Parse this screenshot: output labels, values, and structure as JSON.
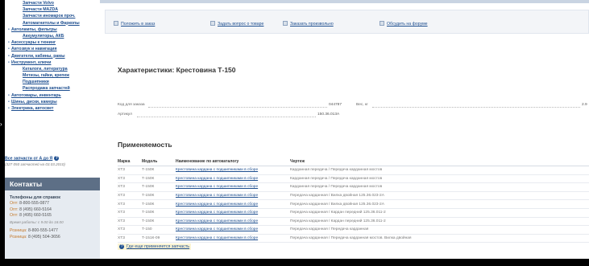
{
  "sidebar": {
    "items": [
      {
        "label": "Запчасти Volvo",
        "top": false
      },
      {
        "label": "Запчасти MAZDA",
        "top": false
      },
      {
        "label": "Запчасти иномарок проч.",
        "top": false
      },
      {
        "label": "Автомагнитолы и Фаркопы",
        "top": false
      },
      {
        "label": "Автолампы, фильтры",
        "top": true
      },
      {
        "label": "Аккумуляторы, АКБ",
        "top": false
      },
      {
        "label": "Аксессуары к тюнинг",
        "top": true
      },
      {
        "label": "Автозвук и навигация",
        "top": true
      },
      {
        "label": "Двигатели, кабины, рамы",
        "top": true
      },
      {
        "label": "Инструмент, ключи",
        "top": true
      },
      {
        "label": "Каталоги, литература",
        "top": false
      },
      {
        "label": "Метизы, гайки, крепеж",
        "top": false
      },
      {
        "label": "Подшипники",
        "top": false
      },
      {
        "label": "Распродажа запчастей",
        "top": false
      },
      {
        "label": "Автотовары, инвентарь",
        "top": true
      },
      {
        "label": "Шины, диски, камеры",
        "top": true
      },
      {
        "label": "Электрика, автосвет",
        "top": true
      }
    ],
    "total_link": "Все запчасти от А до Я",
    "total_note": "(327 050 запчастей на 03.03.2010)"
  },
  "contacts": {
    "title": "Контакты",
    "phones_title": "Телефоны для справок",
    "lines": [
      {
        "label": "Опт:",
        "value": "8-800-555-0877",
        "italic": false
      },
      {
        "label": "Опт:",
        "value": "8 (495) 660-5164",
        "italic": false
      },
      {
        "label": "Опт:",
        "value": "8 (495) 660-5165",
        "italic": false
      },
      {
        "label": "",
        "value": "Время работы: с 9.00 до 18.00",
        "italic": true
      }
    ],
    "retail_lines": [
      {
        "label": "Розница:",
        "value": "8-800-555-1477"
      },
      {
        "label": "Розница:",
        "value": "8 (495) 504-3656"
      }
    ]
  },
  "actions": [
    {
      "label": "Положить в заказ"
    },
    {
      "label": "Задать вопрос о товаре"
    },
    {
      "label": "Заказать произвольно"
    },
    {
      "label": "Обсудить на форуме"
    }
  ],
  "characteristics": {
    "heading": "Характеристики: Крестовина Т-150",
    "code_label": "Код для заказа",
    "code_value": "044787",
    "weight_label": "Вес, кг",
    "weight_value": "2.9",
    "article_label": "Артикул",
    "article_value": "150.36.013А"
  },
  "applicability": {
    "heading": "Применяемость",
    "columns": [
      "Марка",
      "Модель",
      "Наименование по автокаталогу",
      "Чертеж"
    ],
    "rows": [
      [
        "ХТЗ",
        "Т-150К",
        "Крестовина кардана с подшипниками в сборе",
        "Карданная передача / Передача карданная мостов"
      ],
      [
        "ХТЗ",
        "Т-150К",
        "Крестовина кардана с подшипниками в сборе",
        "Карданная передача / Передача карданная мостов"
      ],
      [
        "ХТЗ",
        "Т-150К",
        "Крестовина кардана с подшипниками в сборе",
        "Карданная передача / Передача карданная мостов"
      ],
      [
        "ХТЗ",
        "Т-150К",
        "Крестовина кардана с подшипниками в сборе",
        "Передача карданная / Вилка двойная 125.36.023-2А"
      ],
      [
        "ХТЗ",
        "Т-150К",
        "Крестовина кардана с подшипниками в сборе",
        "Передача карданная / Вилка двойная 125.36.023-2А"
      ],
      [
        "ХТЗ",
        "Т-150К",
        "Крестовина кардана с подшипниками в сборе",
        "Передача карданная / Кардан передний 125.36.011-2"
      ],
      [
        "ХТЗ",
        "Т-150К",
        "Крестовина кардана с подшипниками в сборе",
        "Передача карданная / Кардан передний 125.36.011-2"
      ],
      [
        "ХТЗ",
        "Т-150",
        "Крестовина кардана с подшипниками в сборе",
        "Передача карданная / Передача карданная"
      ],
      [
        "ХТЗ",
        "Т-151К-09",
        "Крестовина кардана с подшипниками в сборе",
        "Передача карданная / Передача карданная мостов. Вилка двойная"
      ]
    ],
    "more_link": "Где еще применяется запчасть"
  }
}
